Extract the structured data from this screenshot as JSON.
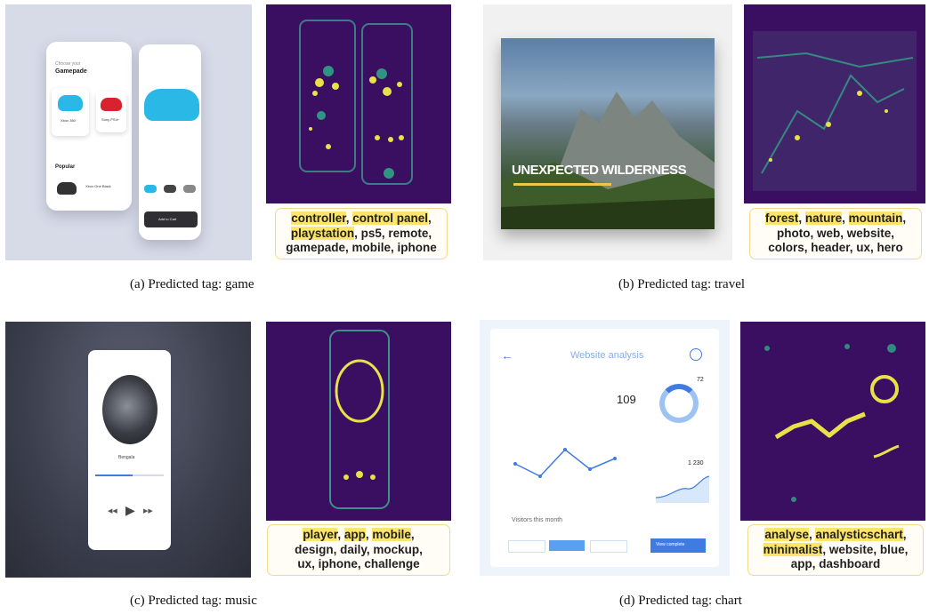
{
  "panels": [
    {
      "caption": "(a)  Predicted tag: game",
      "tags": [
        {
          "t": "controller",
          "hl": true
        },
        {
          "t": ", ",
          "hl": false
        },
        {
          "t": "control panel",
          "hl": true
        },
        {
          "t": ",",
          "hl": false
        },
        {
          "t": "\n",
          "hl": false
        },
        {
          "t": "playstation",
          "hl": true
        },
        {
          "t": ", ps5, remote,",
          "hl": false
        },
        {
          "t": "\n",
          "hl": false
        },
        {
          "t": "gamepade, mobile, iphone",
          "hl": false
        }
      ],
      "mock": {
        "title_small": "Choose your",
        "title": "Gamepade",
        "item1": "Xbox 360",
        "item2": "Sony PS4+",
        "popular": "Popular",
        "item3": "Xbox One Black",
        "add": "Add to Cart"
      }
    },
    {
      "caption": "(b)  Predicted tag: travel",
      "tags": [
        {
          "t": "forest",
          "hl": true
        },
        {
          "t": ", ",
          "hl": false
        },
        {
          "t": "nature",
          "hl": true
        },
        {
          "t": ", ",
          "hl": false
        },
        {
          "t": "mountain",
          "hl": true
        },
        {
          "t": ",",
          "hl": false
        },
        {
          "t": "\n",
          "hl": false
        },
        {
          "t": "photo, web, website,",
          "hl": false
        },
        {
          "t": "\n",
          "hl": false
        },
        {
          "t": "colors, header, ux, hero",
          "hl": false
        }
      ],
      "mock": {
        "headline": "UNEXPECTED WILDERNESS"
      }
    },
    {
      "caption": "(c)  Predicted tag: music",
      "tags": [
        {
          "t": "player",
          "hl": true
        },
        {
          "t": ", ",
          "hl": false
        },
        {
          "t": "app",
          "hl": true
        },
        {
          "t": ", ",
          "hl": false
        },
        {
          "t": "mobile",
          "hl": true
        },
        {
          "t": ",",
          "hl": false
        },
        {
          "t": "\n",
          "hl": false
        },
        {
          "t": "design, daily, mockup,",
          "hl": false
        },
        {
          "t": "\n",
          "hl": false
        },
        {
          "t": "ux, iphone, challenge",
          "hl": false
        }
      ],
      "mock": {
        "song": "Bengala"
      }
    },
    {
      "caption": "(d)  Predicted tag: chart",
      "tags": [
        {
          "t": "analyse",
          "hl": true
        },
        {
          "t": ", ",
          "hl": false
        },
        {
          "t": "analysticschart",
          "hl": true
        },
        {
          "t": ",",
          "hl": false
        },
        {
          "t": "\n",
          "hl": false
        },
        {
          "t": "minimalist",
          "hl": true
        },
        {
          "t": ", website, blue,",
          "hl": false
        },
        {
          "t": "\n",
          "hl": false
        },
        {
          "t": "app, dashboard",
          "hl": false
        }
      ],
      "mock": {
        "title": "Website analysis",
        "kpi": "109",
        "ring": "72",
        "mini": "1 230",
        "footer": "Visitors this month",
        "cta": "View complete"
      }
    }
  ]
}
